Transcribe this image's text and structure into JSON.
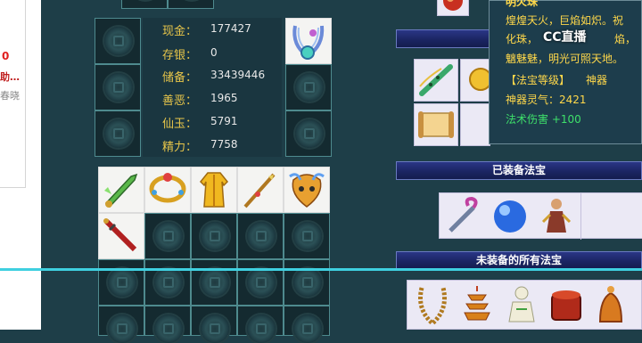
{
  "left_panel": {
    "line1": "0",
    "line2": "助…",
    "line3": "春晓"
  },
  "stats": [
    {
      "label": "现金：",
      "value": "177427"
    },
    {
      "label": "存银：",
      "value": "0"
    },
    {
      "label": "储备：",
      "value": "33439446"
    },
    {
      "label": "善恶：",
      "value": "1965"
    },
    {
      "label": "仙玉：",
      "value": "5791"
    },
    {
      "label": "精力：",
      "value": "7758"
    }
  ],
  "sections": {
    "equipped": "已装备法宝",
    "unequipped": "未装备的所有法宝"
  },
  "tooltip": {
    "title": "明火珠",
    "desc_line1": "煌煌天火，巨焰如炽。祝",
    "desc_line2": "化珠，",
    "watermark": "CC直播",
    "desc_line2_tail": "焰，",
    "desc_line3": "魑魅魅，明光可照天地。",
    "level_label": "【法宝等级】",
    "level_value": "神器",
    "spirit": "神器灵气：2421",
    "damage": "法术伤害 +100"
  },
  "colors": {
    "stat_label": "#e8c64a",
    "tooltip_gold": "#ffd84a",
    "tooltip_green": "#3ee06a",
    "banner": "#1a2460",
    "divider": "#3fd0e0"
  }
}
